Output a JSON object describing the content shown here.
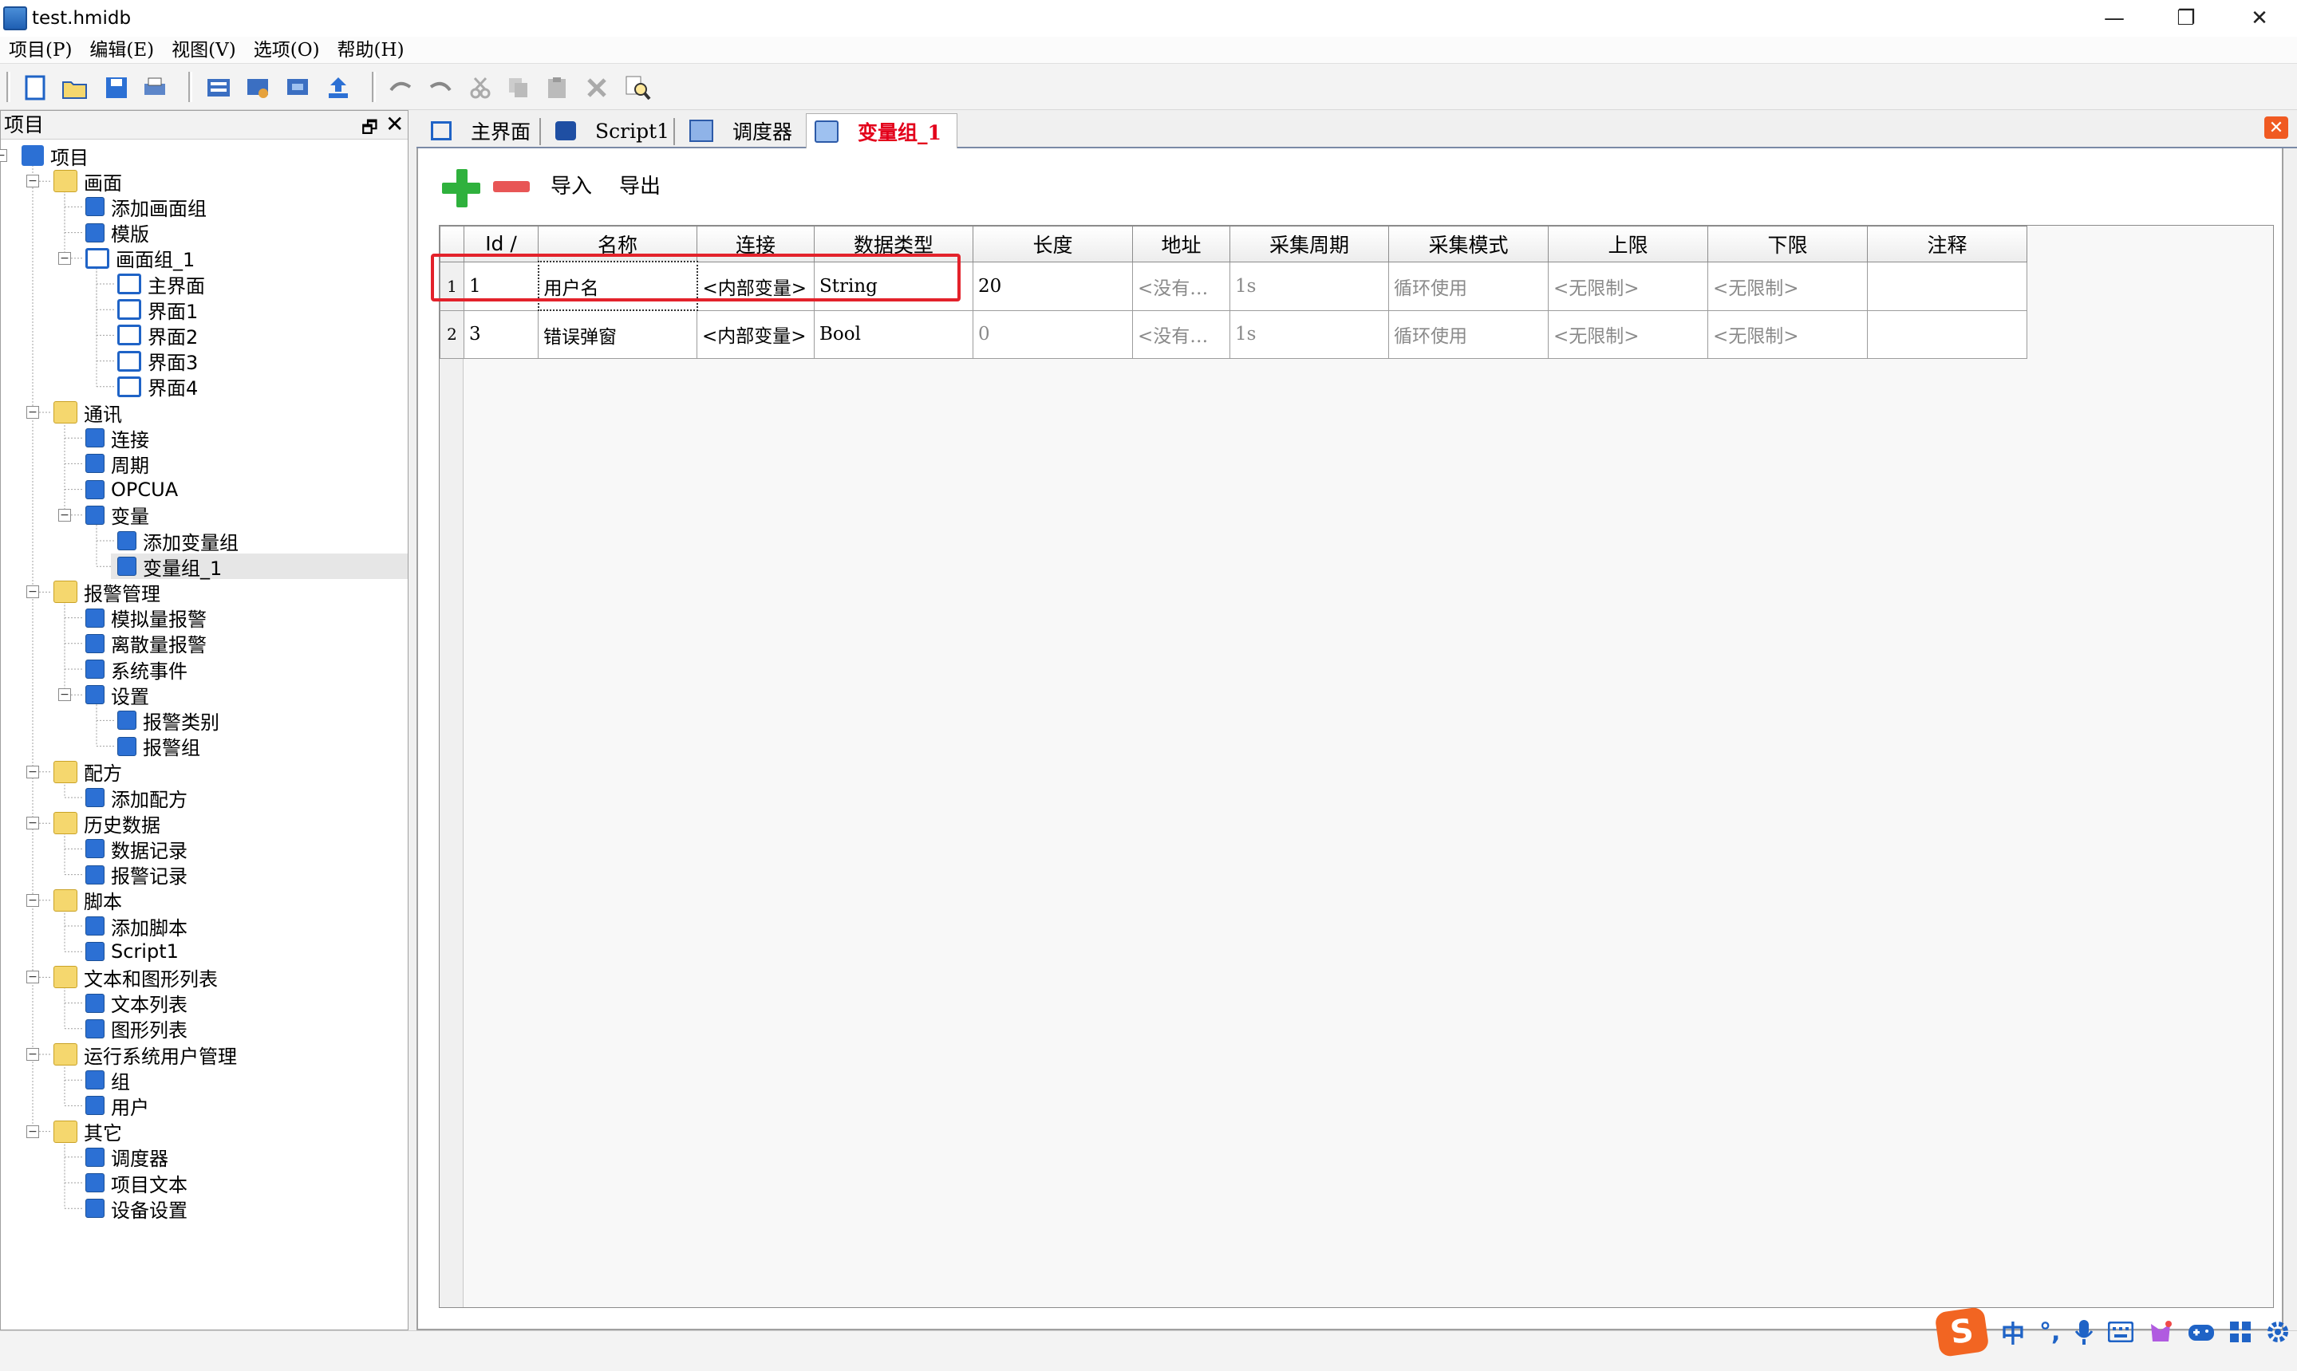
{
  "window": {
    "title": "test.hmidb",
    "minimize": "—",
    "restore": "❐",
    "close": "✕"
  },
  "menu": [
    "项目(P)",
    "编辑(E)",
    "视图(V)",
    "选项(O)",
    "帮助(H)"
  ],
  "toolbar": {
    "icons": [
      "new-icon",
      "open-icon",
      "save-icon",
      "print-icon",
      "compile-icon",
      "download-icon",
      "simulate-icon",
      "upload-icon",
      "undo-icon",
      "redo-icon",
      "cut-icon",
      "copy-icon",
      "paste-icon",
      "delete-icon",
      "find-icon"
    ]
  },
  "pane": {
    "title": "项目",
    "float": "🗗",
    "close": "✕"
  },
  "tree": [
    {
      "label": "项目",
      "level": 0,
      "toggle": "−",
      "icon": "project-icon"
    },
    {
      "label": "画面",
      "level": 1,
      "toggle": "−",
      "icon": "folder-icon"
    },
    {
      "label": "添加画面组",
      "level": 2,
      "icon": "add-screen-group-icon"
    },
    {
      "label": "模版",
      "level": 2,
      "icon": "template-icon"
    },
    {
      "label": "画面组_1",
      "level": 2,
      "toggle": "−",
      "icon": "screen-icon"
    },
    {
      "label": "主界面",
      "level": 3,
      "icon": "screen-icon"
    },
    {
      "label": "界面1",
      "level": 3,
      "icon": "screen-icon"
    },
    {
      "label": "界面2",
      "level": 3,
      "icon": "screen-icon"
    },
    {
      "label": "界面3",
      "level": 3,
      "icon": "screen-icon"
    },
    {
      "label": "界面4",
      "level": 3,
      "icon": "screen-icon"
    },
    {
      "label": "通讯",
      "level": 1,
      "toggle": "−",
      "icon": "folder-icon"
    },
    {
      "label": "连接",
      "level": 2,
      "icon": "connection-icon"
    },
    {
      "label": "周期",
      "level": 2,
      "icon": "cycle-icon"
    },
    {
      "label": "OPCUA",
      "level": 2,
      "icon": "opcua-icon"
    },
    {
      "label": "变量",
      "level": 2,
      "toggle": "−",
      "icon": "variable-icon"
    },
    {
      "label": "添加变量组",
      "level": 3,
      "icon": "add-variable-group-icon"
    },
    {
      "label": "变量组_1",
      "level": 3,
      "icon": "variable-group-icon",
      "selected": true
    },
    {
      "label": "报警管理",
      "level": 1,
      "toggle": "−",
      "icon": "alarm-folder-icon"
    },
    {
      "label": "模拟量报警",
      "level": 2,
      "icon": "analog-alarm-icon"
    },
    {
      "label": "离散量报警",
      "level": 2,
      "icon": "discrete-alarm-icon"
    },
    {
      "label": "系统事件",
      "level": 2,
      "icon": "system-event-icon"
    },
    {
      "label": "设置",
      "level": 2,
      "toggle": "−",
      "icon": "settings-icon"
    },
    {
      "label": "报警类别",
      "level": 3,
      "icon": "alarm-class-icon"
    },
    {
      "label": "报警组",
      "level": 3,
      "icon": "alarm-group-icon"
    },
    {
      "label": "配方",
      "level": 1,
      "toggle": "−",
      "icon": "folder-icon"
    },
    {
      "label": "添加配方",
      "level": 2,
      "icon": "add-recipe-icon"
    },
    {
      "label": "历史数据",
      "level": 1,
      "toggle": "−",
      "icon": "folder-icon"
    },
    {
      "label": "数据记录",
      "level": 2,
      "icon": "data-log-icon"
    },
    {
      "label": "报警记录",
      "level": 2,
      "icon": "alarm-log-icon"
    },
    {
      "label": "脚本",
      "level": 1,
      "toggle": "−",
      "icon": "folder-icon"
    },
    {
      "label": "添加脚本",
      "level": 2,
      "icon": "add-script-icon"
    },
    {
      "label": "Script1",
      "level": 2,
      "icon": "script-icon"
    },
    {
      "label": "文本和图形列表",
      "level": 1,
      "toggle": "−",
      "icon": "folder-icon"
    },
    {
      "label": "文本列表",
      "level": 2,
      "icon": "text-list-icon"
    },
    {
      "label": "图形列表",
      "level": 2,
      "icon": "graphic-list-icon"
    },
    {
      "label": "运行系统用户管理",
      "level": 1,
      "toggle": "−",
      "icon": "user-folder-icon"
    },
    {
      "label": "组",
      "level": 2,
      "icon": "group-icon"
    },
    {
      "label": "用户",
      "level": 2,
      "icon": "user-icon"
    },
    {
      "label": "其它",
      "level": 1,
      "toggle": "−",
      "icon": "folder-icon"
    },
    {
      "label": "调度器",
      "level": 2,
      "icon": "scheduler-icon"
    },
    {
      "label": "项目文本",
      "level": 2,
      "icon": "project-text-icon"
    },
    {
      "label": "设备设置",
      "level": 2,
      "icon": "device-settings-icon"
    }
  ],
  "tabs": [
    {
      "label": "主界面",
      "icon": "screen-icon"
    },
    {
      "label": "Script1",
      "icon": "script-icon"
    },
    {
      "label": "调度器",
      "icon": "scheduler-icon"
    },
    {
      "label": "变量组_1",
      "icon": "variable-group-icon",
      "active": true
    }
  ],
  "tab_close": "✕",
  "actions": {
    "add": "add-icon",
    "remove": "remove-icon",
    "import": "导入",
    "export": "导出"
  },
  "grid": {
    "columns": [
      "Id ∕",
      "名称",
      "连接",
      "数据类型",
      "长度",
      "地址",
      "采集周期",
      "采集模式",
      "上限",
      "下限",
      "注释"
    ],
    "rows": [
      {
        "rownum": "1",
        "cells": [
          "1",
          "用户名",
          "<内部变量>",
          "String",
          "20",
          "<没有…",
          "1s",
          "循环使用",
          "<无限制>",
          "<无限制>",
          ""
        ]
      },
      {
        "rownum": "2",
        "cells": [
          "3",
          "错误弹窗",
          "<内部变量>",
          "Bool",
          "0",
          "<没有…",
          "1s",
          "循环使用",
          "<无限制>",
          "<无限制>",
          ""
        ]
      }
    ]
  },
  "ime": {
    "logo": "S",
    "lang": "中",
    "punct": "°,",
    "mic": "mic-icon",
    "keyboard": "keyboard-icon",
    "skin": "skin-icon",
    "game": "game-icon",
    "apps": "apps-icon",
    "settings": "settings-icon"
  }
}
